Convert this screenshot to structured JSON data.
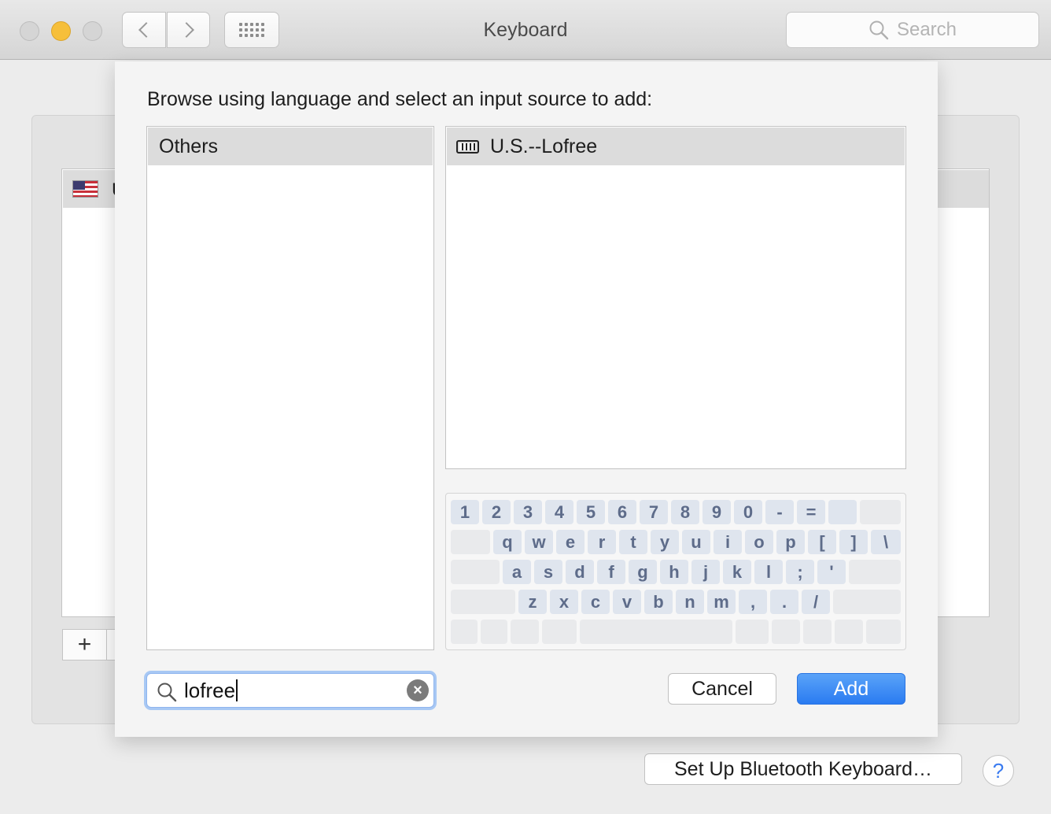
{
  "window": {
    "title": "Keyboard",
    "search_placeholder": "Search"
  },
  "background": {
    "list_row_text": "U",
    "add_button": "+",
    "bluetooth_button": "Set Up Bluetooth Keyboard…",
    "help_button": "?"
  },
  "sheet": {
    "prompt": "Browse using language and select an input source to add:",
    "languages": [
      "Others"
    ],
    "sources": [
      "U.S.--Lofree"
    ],
    "search_value": "lofree",
    "cancel_label": "Cancel",
    "add_label": "Add"
  },
  "keyboard_viewer": {
    "row1": [
      "1",
      "2",
      "3",
      "4",
      "5",
      "6",
      "7",
      "8",
      "9",
      "0",
      "-",
      "="
    ],
    "row2": [
      "q",
      "w",
      "e",
      "r",
      "t",
      "y",
      "u",
      "i",
      "o",
      "p",
      "[",
      "]",
      "\\"
    ],
    "row3": [
      "a",
      "s",
      "d",
      "f",
      "g",
      "h",
      "j",
      "k",
      "l",
      ";",
      "'"
    ],
    "row4": [
      "z",
      "x",
      "c",
      "v",
      "b",
      "n",
      "m",
      ",",
      ".",
      "/"
    ]
  },
  "colors": {
    "accent": "#2a7bf1",
    "minimize_light": "#f6bf3a",
    "key_legend": "#5e6c8a"
  },
  "icons": {
    "search": "magnifier-icon",
    "keyboard": "keyboard-icon",
    "flag": "us-flag-icon",
    "clear": "clear-x-icon"
  }
}
